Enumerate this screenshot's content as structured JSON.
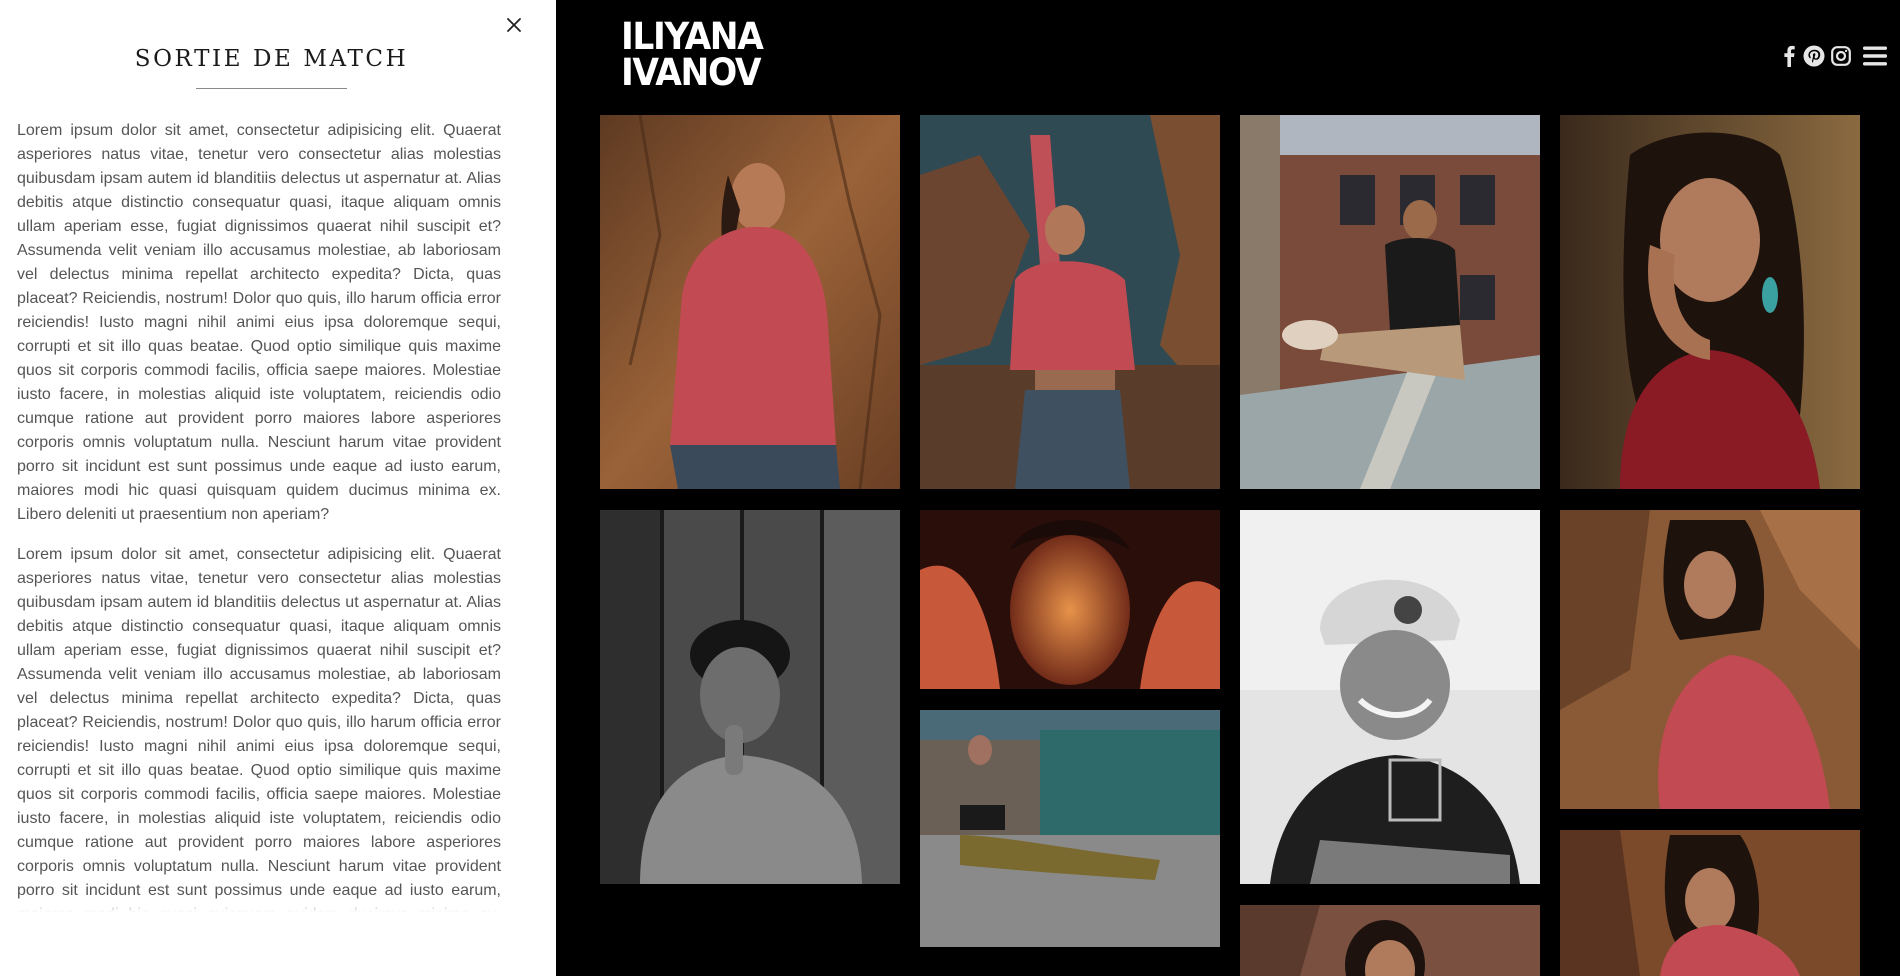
{
  "panel": {
    "close_icon": "close-icon",
    "title": "SORTIE DE MATCH",
    "paragraphs": [
      "Lorem ipsum dolor sit amet, consectetur adipisicing elit. Quaerat asperiores natus vitae, tenetur vero consectetur alias molestias quibusdam ipsam autem id blanditiis delectus ut aspernatur at. Alias debitis atque distinctio consequatur quasi, itaque aliquam omnis ullam aperiam esse, fugiat dignissimos quaerat nihil suscipit et? Assumenda velit veniam illo accusamus molestiae, ab laboriosam vel delectus minima repellat architecto expedita? Dicta, quas placeat? Reiciendis, nostrum! Dolor quo quis, illo harum officia error reiciendis! Iusto magni nihil animi eius ipsa doloremque sequi, corrupti et sit illo quas beatae. Quod optio similique quis maxime quos sit corporis commodi facilis, officia saepe maiores. Molestiae iusto facere, in molestias aliquid iste voluptatem, reiciendis odio cumque ratione aut provident porro maiores labore asperiores corporis omnis voluptatum nulla. Nesciunt harum vitae provident porro sit incidunt est sunt possimus unde eaque ad iusto earum, maiores modi hic quasi quisquam quidem ducimus minima ex. Libero deleniti ut praesentium non aperiam?",
      "Lorem ipsum dolor sit amet, consectetur adipisicing elit. Quaerat asperiores natus vitae, tenetur vero consectetur alias molestias quibusdam ipsam autem id blanditiis delectus ut aspernatur at. Alias debitis atque distinctio consequatur quasi, itaque aliquam omnis ullam aperiam esse, fugiat dignissimos quaerat nihil suscipit et? Assumenda velit veniam illo accusamus molestiae, ab laboriosam vel delectus minima repellat architecto expedita? Dicta, quas placeat? Reiciendis, nostrum! Dolor quo quis, illo harum officia error reiciendis! Iusto magni nihil animi eius ipsa doloremque sequi, corrupti et sit illo quas beatae. Quod optio similique quis maxime quos sit corporis commodi facilis, officia saepe maiores. Molestiae iusto facere, in molestias aliquid iste voluptatem, reiciendis odio cumque ratione aut provident porro maiores labore asperiores corporis omnis voluptatum nulla. Nesciunt harum vitae provident porro sit incidunt est sunt possimus unde eaque ad iusto earum, maiores modi hic quasi quisquam quidem ducimus minima ex. Libero deleniti ut"
    ]
  },
  "header": {
    "logo_line1": "ILIYANA",
    "logo_line2": "IVANOV",
    "icons": [
      "facebook-icon",
      "pinterest-icon",
      "instagram-icon",
      "menu-icon"
    ]
  },
  "colors": {
    "background": "#000000",
    "panel": "#ffffff",
    "text": "#555555",
    "title": "#1a1a1a"
  },
  "gallery": [
    {
      "name": "photo-woman-pink-sweater-rock"
    },
    {
      "name": "photo-woman-arms-raised-canyon"
    },
    {
      "name": "photo-man-sitting-rooftop"
    },
    {
      "name": "photo-woman-hand-on-face"
    },
    {
      "name": "photo-man-bw-wooden-wall"
    },
    {
      "name": "photo-woman-face-closeup-red-light"
    },
    {
      "name": "photo-woman-sitting-street"
    },
    {
      "name": "photo-man-bw-smiling-beanie"
    },
    {
      "name": "photo-woman-pink-sweater-profile"
    },
    {
      "name": "photo-woman-pink-sweater-rock-2"
    },
    {
      "name": "photo-woman-portrait-partial"
    }
  ]
}
